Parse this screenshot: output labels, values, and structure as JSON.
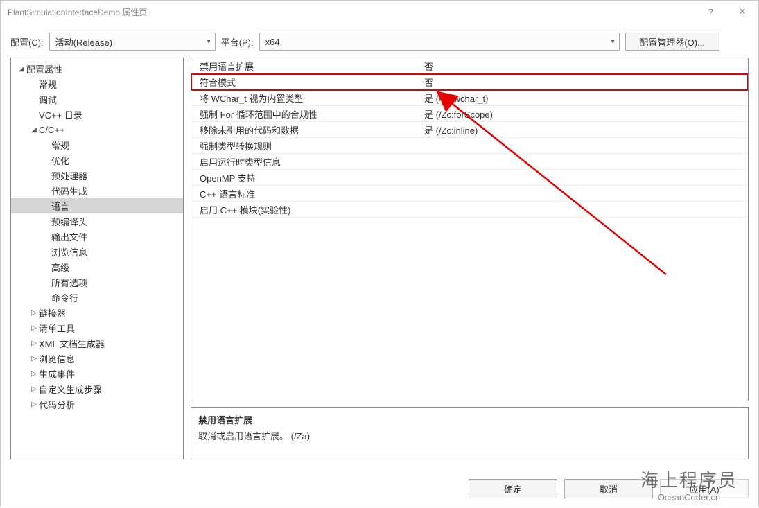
{
  "window": {
    "title": "PlantSimulationInterfaceDemo 属性页",
    "help": "?",
    "close": "✕"
  },
  "topbar": {
    "config_label": "配置(C):",
    "config_value": "活动(Release)",
    "platform_label": "平台(P):",
    "platform_value": "x64",
    "manager_button": "配置管理器(O)..."
  },
  "tree": {
    "root": "配置属性",
    "general": "常规",
    "debug": "调试",
    "vcdirs": "VC++ 目录",
    "ccpp": "C/C++",
    "ccpp_children": {
      "general": "常规",
      "optimize": "优化",
      "preproc": "预处理器",
      "codegen": "代码生成",
      "language": "语言",
      "pch": "预编译头",
      "output": "输出文件",
      "browse": "浏览信息",
      "advanced": "高级",
      "all": "所有选项",
      "cmdline": "命令行"
    },
    "linker": "链接器",
    "manifest": "清单工具",
    "xmldoc": "XML 文档生成器",
    "browseinfo": "浏览信息",
    "buildevents": "生成事件",
    "custombuild": "自定义生成步骤",
    "codeanalysis": "代码分析"
  },
  "grid": {
    "rows": [
      {
        "name": "禁用语言扩展",
        "value": "否",
        "hl": false
      },
      {
        "name": "符合模式",
        "value": "否",
        "hl": true
      },
      {
        "name": "将 WChar_t 视为内置类型",
        "value": "是 (/Zc:wchar_t)",
        "hl": false
      },
      {
        "name": "强制 For 循环范围中的合规性",
        "value": "是 (/Zc:forScope)",
        "hl": false
      },
      {
        "name": "移除未引用的代码和数据",
        "value": "是 (/Zc:inline)",
        "hl": false
      },
      {
        "name": "强制类型转换规则",
        "value": "",
        "hl": false
      },
      {
        "name": "启用运行时类型信息",
        "value": "",
        "hl": false
      },
      {
        "name": "OpenMP 支持",
        "value": "",
        "hl": false
      },
      {
        "name": "C++ 语言标准",
        "value": "",
        "hl": false
      },
      {
        "name": "启用 C++ 模块(实验性)",
        "value": "",
        "hl": false
      }
    ]
  },
  "description": {
    "title": "禁用语言扩展",
    "body": "取消或启用语言扩展。     (/Za)"
  },
  "footer": {
    "ok": "确定",
    "cancel": "取消",
    "apply": "应用(A)"
  },
  "watermark": {
    "line1": "海上程序员",
    "line2": "OceanCoder.cn"
  }
}
